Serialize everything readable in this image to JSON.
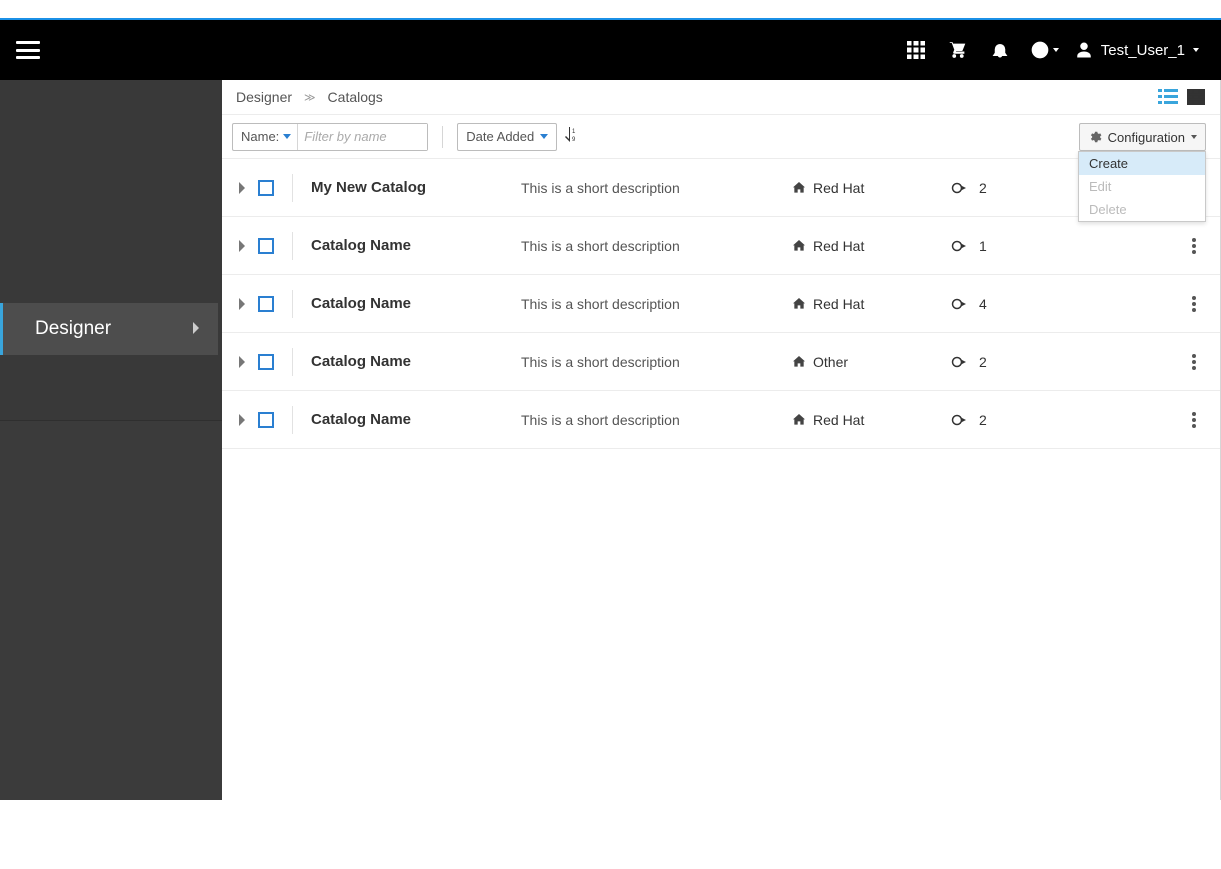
{
  "header": {
    "username": "Test_User_1"
  },
  "sidebar": {
    "active_item": "Designer"
  },
  "breadcrumbs": [
    "Designer",
    "Catalogs"
  ],
  "filter": {
    "field_label": "Name:",
    "placeholder": "Filter by name",
    "value": ""
  },
  "sort": {
    "selected": "Date Added"
  },
  "config": {
    "button_label": "Configuration",
    "menu": [
      {
        "label": "Create",
        "enabled": true,
        "hover": true
      },
      {
        "label": "Edit",
        "enabled": false,
        "hover": false
      },
      {
        "label": "Delete",
        "enabled": false,
        "hover": false
      }
    ]
  },
  "rows": [
    {
      "name": "My New Catalog",
      "desc": "This is a short description",
      "tag": "Red Hat",
      "count": "2",
      "show_kebab": false
    },
    {
      "name": "Catalog Name",
      "desc": "This is a short description",
      "tag": "Red Hat",
      "count": "1",
      "show_kebab": true
    },
    {
      "name": "Catalog Name",
      "desc": "This is a short description",
      "tag": "Red Hat",
      "count": "4",
      "show_kebab": true
    },
    {
      "name": "Catalog Name",
      "desc": "This is a short description",
      "tag": "Other",
      "count": "2",
      "show_kebab": true
    },
    {
      "name": "Catalog Name",
      "desc": "This is a short description",
      "tag": "Red Hat",
      "count": "2",
      "show_kebab": true
    }
  ]
}
